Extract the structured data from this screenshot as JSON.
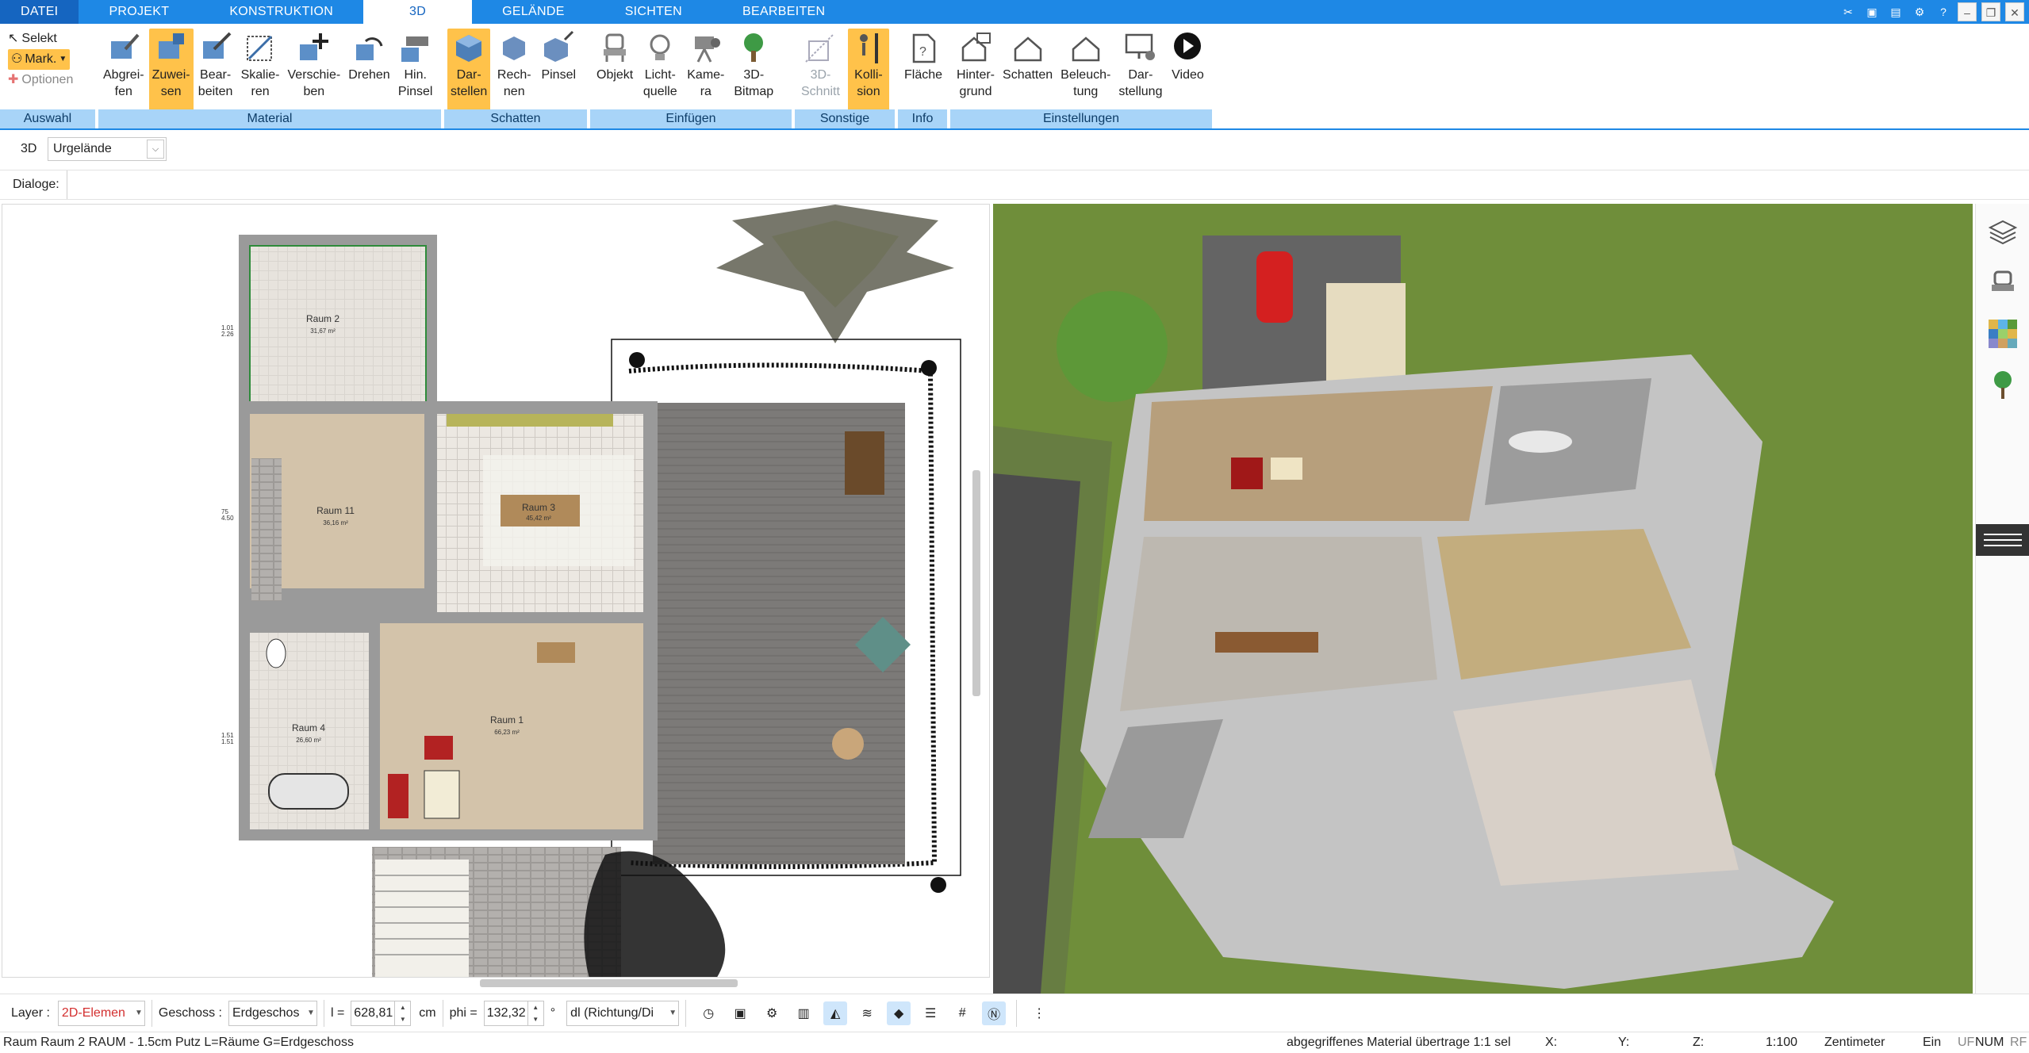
{
  "menu": {
    "tabs": [
      "DATEI",
      "PROJEKT",
      "KONSTRUKTION",
      "3D",
      "GELÄNDE",
      "SICHTEN",
      "BEARBEITEN"
    ],
    "active_tab": "3D"
  },
  "ribbon": {
    "auswahl": {
      "selekt": "Selekt",
      "mark": "Mark.",
      "optionen": "Optionen",
      "label": "Auswahl"
    },
    "material": {
      "label": "Material",
      "buttons": [
        {
          "l1": "Abgrei-",
          "l2": "fen"
        },
        {
          "l1": "Zuwei-",
          "l2": "sen"
        },
        {
          "l1": "Bear-",
          "l2": "beiten"
        },
        {
          "l1": "Skalie-",
          "l2": "ren"
        },
        {
          "l1": "Verschie-",
          "l2": "ben"
        },
        {
          "l1": "Drehen",
          "l2": ""
        },
        {
          "l1": "Hin.",
          "l2": "Pinsel"
        }
      ]
    },
    "schatten": {
      "label": "Schatten",
      "buttons": [
        {
          "l1": "Dar-",
          "l2": "stellen"
        },
        {
          "l1": "Rech-",
          "l2": "nen"
        },
        {
          "l1": "Pinsel",
          "l2": ""
        }
      ]
    },
    "einfuegen": {
      "label": "Einfügen",
      "buttons": [
        {
          "l1": "Objekt",
          "l2": ""
        },
        {
          "l1": "Licht-",
          "l2": "quelle"
        },
        {
          "l1": "Kame-",
          "l2": "ra"
        },
        {
          "l1": "3D-",
          "l2": "Bitmap"
        }
      ]
    },
    "sonstige": {
      "label": "Sonstige",
      "buttons": [
        {
          "l1": "3D-",
          "l2": "Schnitt"
        },
        {
          "l1": "Kolli-",
          "l2": "sion"
        }
      ]
    },
    "info": {
      "label": "Info",
      "buttons": [
        {
          "l1": "Fläche",
          "l2": ""
        }
      ]
    },
    "einstellungen": {
      "label": "Einstellungen",
      "buttons": [
        {
          "l1": "Hinter-",
          "l2": "grund"
        },
        {
          "l1": "Schatten",
          "l2": ""
        },
        {
          "l1": "Beleuch-",
          "l2": "tung"
        },
        {
          "l1": "Dar-",
          "l2": "stellung"
        },
        {
          "l1": "Video",
          "l2": ""
        }
      ]
    }
  },
  "toolbar2": {
    "mode": "3D",
    "terrain": "Urgelände"
  },
  "dialogs_label": "Dialoge:",
  "plan": {
    "rooms": [
      {
        "name": "Raum 2",
        "area": "31,67 m²"
      },
      {
        "name": "Raum 11",
        "area": "36,16 m²"
      },
      {
        "name": "Raum 3",
        "area": "45,42 m²"
      },
      {
        "name": "Raum 4",
        "area": "26,60 m²"
      },
      {
        "name": "Raum 1",
        "area": "66,23 m²"
      }
    ],
    "dims": [
      "1.01",
      "2.26",
      "75",
      "4.50",
      "1.51",
      "1.51"
    ]
  },
  "bottombar": {
    "layer_label": "Layer :",
    "layer_value": "2D-Elemen",
    "geschoss_label": "Geschoss :",
    "geschoss_value": "Erdgeschos",
    "l_label": "l =",
    "l_value": "628,81",
    "l_unit": "cm",
    "phi_label": "phi =",
    "phi_value": "132,32",
    "phi_unit": "°",
    "dl_value": "dl (Richtung/Di"
  },
  "statusbar": {
    "left": "Raum Raum 2 RAUM - 1.5cm Putz L=Räume G=Erdgeschoss",
    "message": "abgegriffenes Material übertrage 1:1 sel",
    "x": "X:",
    "y": "Y:",
    "z": "Z:",
    "scale": "1:100",
    "unit": "Zentimeter",
    "ein": "Ein",
    "uf": "UF",
    "num": "NUM",
    "rf": "RF"
  },
  "colors": {
    "accent": "#1e88e5",
    "ribbon_label_bg": "#a8d4f8",
    "selected": "#ffc24a",
    "grass": "#6f8e3a"
  }
}
